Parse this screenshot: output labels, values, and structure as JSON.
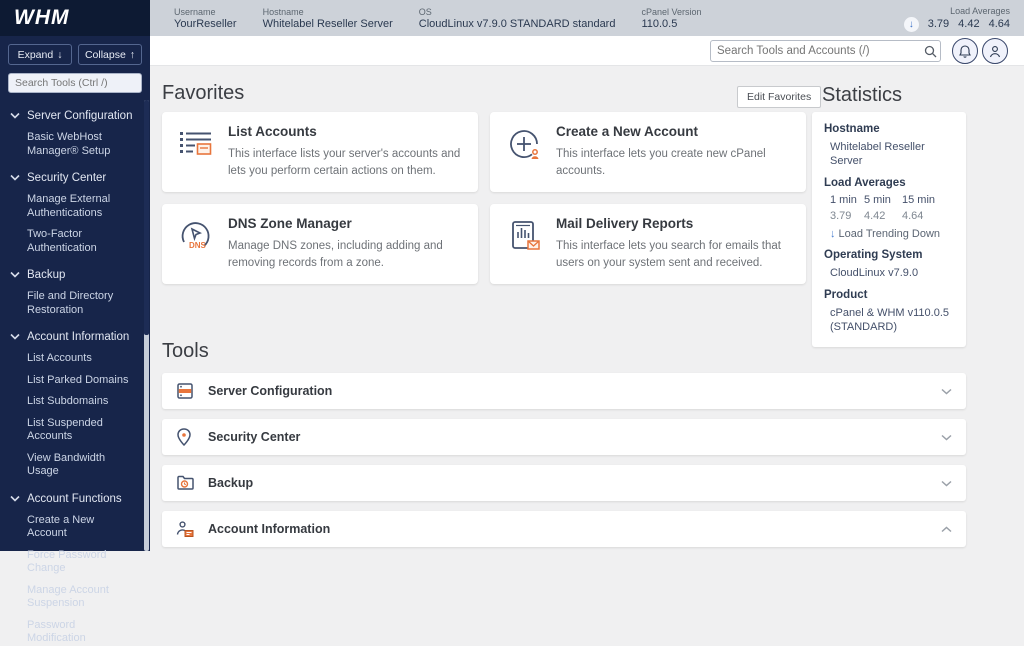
{
  "topbar": {
    "logo": "WHM",
    "fields": [
      {
        "label": "Username",
        "value": "YourReseller"
      },
      {
        "label": "Hostname",
        "value": "Whitelabel Reseller Server"
      },
      {
        "label": "OS",
        "value": "CloudLinux v7.9.0 STANDARD standard"
      },
      {
        "label": "cPanel Version",
        "value": "110.0.5"
      }
    ],
    "load": {
      "label": "Load Averages",
      "values": [
        "3.79",
        "4.42",
        "4.64"
      ]
    }
  },
  "sidebar": {
    "expand_label": "Expand",
    "collapse_label": "Collapse",
    "search_placeholder": "Search Tools (Ctrl /)",
    "sections": [
      {
        "label": "Server Configuration",
        "items": [
          "Basic WebHost Manager® Setup"
        ]
      },
      {
        "label": "Security Center",
        "items": [
          "Manage External Authentications",
          "Two-Factor Authentication"
        ]
      },
      {
        "label": "Backup",
        "items": [
          "File and Directory Restoration"
        ]
      },
      {
        "label": "Account Information",
        "items": [
          "List Accounts",
          "List Parked Domains",
          "List Subdomains",
          "List Suspended Accounts",
          "View Bandwidth Usage"
        ]
      },
      {
        "label": "Account Functions",
        "items": [
          "Create a New Account",
          "Force Password Change",
          "Manage Account Suspension",
          "Password Modification"
        ]
      }
    ]
  },
  "header": {
    "search_placeholder": "Search Tools and Accounts (/)"
  },
  "favorites": {
    "title": "Favorites",
    "edit_button": "Edit Favorites",
    "cards": [
      {
        "title": "List Accounts",
        "description": "This interface lists your server's accounts and lets you perform certain actions on them.",
        "icon": "list-accounts-icon"
      },
      {
        "title": "Create a New Account",
        "description": "This interface lets you create new cPanel accounts.",
        "icon": "create-new-account-icon"
      },
      {
        "title": "DNS Zone Manager",
        "description": "Manage DNS zones, including adding and removing records from a zone.",
        "icon": "dns-zone-manager-icon"
      },
      {
        "title": "Mail Delivery Reports",
        "description": "This interface lets you search for emails that users on your system sent and received.",
        "icon": "mail-delivery-reports-icon"
      }
    ]
  },
  "statistics": {
    "title": "Statistics",
    "hostname_label": "Hostname",
    "hostname": "Whitelabel Reseller Server",
    "load_label": "Load Averages",
    "load_cols": [
      "1 min",
      "5 min",
      "15 min"
    ],
    "load_vals": [
      "3.79",
      "4.42",
      "4.64"
    ],
    "trend": "Load Trending Down",
    "os_label": "Operating System",
    "os": "CloudLinux v7.9.0",
    "product_label": "Product",
    "product": "cPanel & WHM v110.0.5 (STANDARD)"
  },
  "tools": {
    "title": "Tools",
    "groups": [
      {
        "label": "Server Configuration",
        "state": "collapsed"
      },
      {
        "label": "Security Center",
        "state": "collapsed"
      },
      {
        "label": "Backup",
        "state": "collapsed"
      },
      {
        "label": "Account Information",
        "state": "expanded"
      }
    ]
  },
  "colors": {
    "navy_dark": "#0d1a33",
    "sidebar_navy": "#17254a",
    "topbar_gray": "#cdd2d9",
    "accent_orange": "#e8753c",
    "trend_blue": "#4a7fd0"
  }
}
